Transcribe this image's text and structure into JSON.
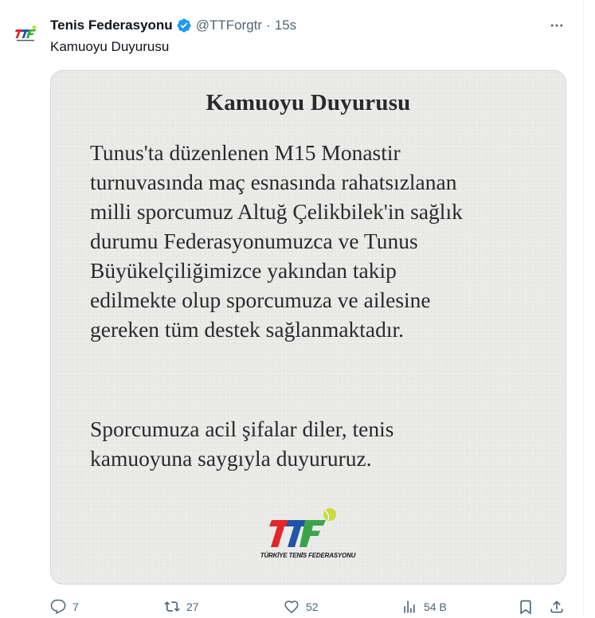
{
  "tweet": {
    "author_name": "Tenis Federasyonu",
    "handle": "@TTForgtr",
    "separator": "·",
    "time": "15s",
    "text": "Kamuoyu Duyurusu"
  },
  "media": {
    "title": "Kamuoyu Duyurusu",
    "body": "Tunus'ta düzenlenen M15 Monastir\nturnuvasında maç esnasında rahatsızlanan\nmilli sporcumuz Altuğ Çelikbilek'in sağlık\ndurumu Federasyonumuzca ve Tunus\nBüyükelçiliğimizce yakından takip\nedilmekte olup sporcumuza ve ailesine\ngereken tüm destek sağlanmaktadır.",
    "closing": "Sporcumuza acil şifalar diler, tenis\nkamuoyuna saygıyla duyururuz.",
    "logo_text": "TTF",
    "logo_caption": "TÜRKİYE TENİS FEDERASYONU"
  },
  "actions": {
    "replies": "7",
    "reposts": "27",
    "likes": "52",
    "views": "54 B"
  },
  "colors": {
    "text_primary": "#0f1419",
    "text_secondary": "#536471",
    "verified_blue": "#1d9bf0",
    "logo_red": "#e3262b",
    "logo_blue": "#1f56a6",
    "logo_green": "#3aa548",
    "ball_yellow": "#c9dc3b"
  },
  "icons": [
    "verified-badge-icon",
    "more-icon",
    "reply-icon",
    "repost-icon",
    "like-icon",
    "views-icon",
    "bookmark-icon",
    "share-icon"
  ]
}
